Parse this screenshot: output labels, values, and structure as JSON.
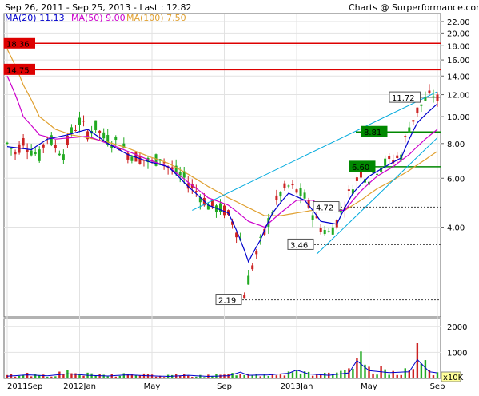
{
  "header": {
    "range": "Sep 26, 2011 - Sep 25, 2013 - Last : 12.82",
    "source": "Charts @ Surperformance.com"
  },
  "legend": [
    {
      "label": "MA(20)",
      "value": "11.13",
      "color": "#0000cc"
    },
    {
      "label": "MA(50)",
      "value": "9.00",
      "color": "#cc00cc"
    },
    {
      "label": "MA(100)",
      "value": "7.50",
      "color": "#e0a030"
    }
  ],
  "colors": {
    "up": "#22aa22",
    "down": "#cc2222",
    "trend": "#00aadd",
    "resistance": "#dd0000",
    "support": "#008800",
    "frame": "#666666"
  },
  "chart_data": {
    "type": "candlestick",
    "scale": "log",
    "ylim": [
      1.9,
      23.5
    ],
    "y_ticks": [
      "22.00",
      "20.00",
      "18.00",
      "16.00",
      "14.00",
      "12.00",
      "10.00",
      "8.00",
      "6.00",
      "4.00"
    ],
    "x_ticks": [
      "2011Sep",
      "2012Jan",
      "May",
      "Sep",
      "2013Jan",
      "May",
      "Sep"
    ],
    "price_path": [
      [
        0,
        8.0
      ],
      [
        2,
        7.4
      ],
      [
        4,
        8.2
      ],
      [
        6,
        7.6
      ],
      [
        8,
        7.2
      ],
      [
        10,
        8.6
      ],
      [
        12,
        7.8
      ],
      [
        14,
        7.4
      ],
      [
        16,
        8.8
      ],
      [
        18,
        9.6
      ],
      [
        20,
        8.8
      ],
      [
        22,
        9.2
      ],
      [
        24,
        8.4
      ],
      [
        26,
        8.2
      ],
      [
        28,
        8.0
      ],
      [
        30,
        7.4
      ],
      [
        32,
        7.2
      ],
      [
        34,
        7.0
      ],
      [
        36,
        6.8
      ],
      [
        38,
        7.2
      ],
      [
        40,
        6.6
      ],
      [
        42,
        6.3
      ],
      [
        44,
        6.0
      ],
      [
        46,
        5.6
      ],
      [
        48,
        5.2
      ],
      [
        50,
        4.8
      ],
      [
        52,
        4.7
      ],
      [
        54,
        4.6
      ],
      [
        56,
        4.2
      ],
      [
        58,
        3.6
      ],
      [
        59,
        2.3
      ],
      [
        60,
        2.6
      ],
      [
        62,
        3.2
      ],
      [
        64,
        3.8
      ],
      [
        66,
        4.6
      ],
      [
        68,
        5.3
      ],
      [
        70,
        5.6
      ],
      [
        72,
        5.4
      ],
      [
        74,
        5.1
      ],
      [
        76,
        4.5
      ],
      [
        78,
        4.0
      ],
      [
        80,
        3.8
      ],
      [
        82,
        4.2
      ],
      [
        84,
        4.9
      ],
      [
        86,
        5.6
      ],
      [
        88,
        6.3
      ],
      [
        90,
        6.0
      ],
      [
        92,
        6.5
      ],
      [
        94,
        6.8
      ],
      [
        96,
        7.0
      ],
      [
        98,
        7.3
      ],
      [
        100,
        9.2
      ],
      [
        102,
        10.5
      ],
      [
        104,
        11.5
      ],
      [
        106,
        12.0
      ],
      [
        107,
        11.5
      ]
    ],
    "volume_path": [
      [
        0,
        100
      ],
      [
        5,
        160
      ],
      [
        10,
        120
      ],
      [
        15,
        210
      ],
      [
        20,
        140
      ],
      [
        25,
        110
      ],
      [
        30,
        160
      ],
      [
        35,
        120
      ],
      [
        40,
        90
      ],
      [
        45,
        140
      ],
      [
        50,
        90
      ],
      [
        55,
        120
      ],
      [
        58,
        280
      ],
      [
        60,
        140
      ],
      [
        65,
        160
      ],
      [
        70,
        230
      ],
      [
        72,
        380
      ],
      [
        75,
        200
      ],
      [
        80,
        140
      ],
      [
        85,
        250
      ],
      [
        87,
        800
      ],
      [
        90,
        350
      ],
      [
        95,
        260
      ],
      [
        100,
        300
      ],
      [
        102,
        850
      ],
      [
        105,
        300
      ],
      [
        107,
        250
      ]
    ],
    "volume_ticks": [
      "2000",
      "1000",
      "x10K"
    ],
    "ma20_points": [
      [
        0,
        7.8
      ],
      [
        6,
        7.6
      ],
      [
        10,
        8.3
      ],
      [
        15,
        8.6
      ],
      [
        20,
        9.0
      ],
      [
        25,
        8.0
      ],
      [
        30,
        7.3
      ],
      [
        35,
        6.9
      ],
      [
        40,
        6.6
      ],
      [
        45,
        5.6
      ],
      [
        50,
        4.8
      ],
      [
        55,
        4.5
      ],
      [
        58,
        3.6
      ],
      [
        60,
        3.0
      ],
      [
        63,
        3.6
      ],
      [
        66,
        4.5
      ],
      [
        70,
        5.3
      ],
      [
        74,
        5.0
      ],
      [
        78,
        4.2
      ],
      [
        82,
        4.1
      ],
      [
        86,
        5.3
      ],
      [
        90,
        6.1
      ],
      [
        94,
        6.6
      ],
      [
        98,
        7.1
      ],
      [
        102,
        9.5
      ],
      [
        107,
        11.13
      ]
    ],
    "ma50_points": [
      [
        0,
        14.0
      ],
      [
        4,
        10.0
      ],
      [
        8,
        8.6
      ],
      [
        12,
        8.3
      ],
      [
        16,
        8.4
      ],
      [
        20,
        8.5
      ],
      [
        25,
        8.0
      ],
      [
        30,
        7.5
      ],
      [
        35,
        7.0
      ],
      [
        40,
        6.6
      ],
      [
        45,
        5.8
      ],
      [
        50,
        5.1
      ],
      [
        55,
        4.8
      ],
      [
        60,
        4.2
      ],
      [
        64,
        4.0
      ],
      [
        68,
        4.5
      ],
      [
        72,
        5.0
      ],
      [
        76,
        5.0
      ],
      [
        80,
        4.6
      ],
      [
        84,
        4.6
      ],
      [
        88,
        5.4
      ],
      [
        92,
        6.1
      ],
      [
        96,
        6.6
      ],
      [
        100,
        7.3
      ],
      [
        104,
        8.3
      ],
      [
        107,
        9.0
      ]
    ],
    "ma100_points": [
      [
        0,
        17.5
      ],
      [
        4,
        13.0
      ],
      [
        8,
        10.0
      ],
      [
        12,
        9.0
      ],
      [
        16,
        8.6
      ],
      [
        20,
        8.4
      ],
      [
        25,
        8.1
      ],
      [
        30,
        7.7
      ],
      [
        35,
        7.2
      ],
      [
        40,
        6.8
      ],
      [
        45,
        6.2
      ],
      [
        50,
        5.6
      ],
      [
        55,
        5.1
      ],
      [
        60,
        4.7
      ],
      [
        64,
        4.4
      ],
      [
        68,
        4.4
      ],
      [
        72,
        4.5
      ],
      [
        76,
        4.6
      ],
      [
        80,
        4.6
      ],
      [
        84,
        4.6
      ],
      [
        88,
        5.0
      ],
      [
        92,
        5.5
      ],
      [
        96,
        5.9
      ],
      [
        100,
        6.4
      ],
      [
        104,
        7.0
      ],
      [
        107,
        7.5
      ]
    ],
    "levels": [
      {
        "label": "18.36",
        "kind": "resistance"
      },
      {
        "label": "14.75",
        "kind": "resistance"
      },
      {
        "label": "11.72",
        "kind": "plain"
      },
      {
        "label": "8.81",
        "kind": "support"
      },
      {
        "label": "6.60",
        "kind": "support"
      },
      {
        "label": "4.72",
        "kind": "dashed"
      },
      {
        "label": "3.46",
        "kind": "dashed"
      },
      {
        "label": "2.19",
        "kind": "dashed"
      }
    ]
  }
}
